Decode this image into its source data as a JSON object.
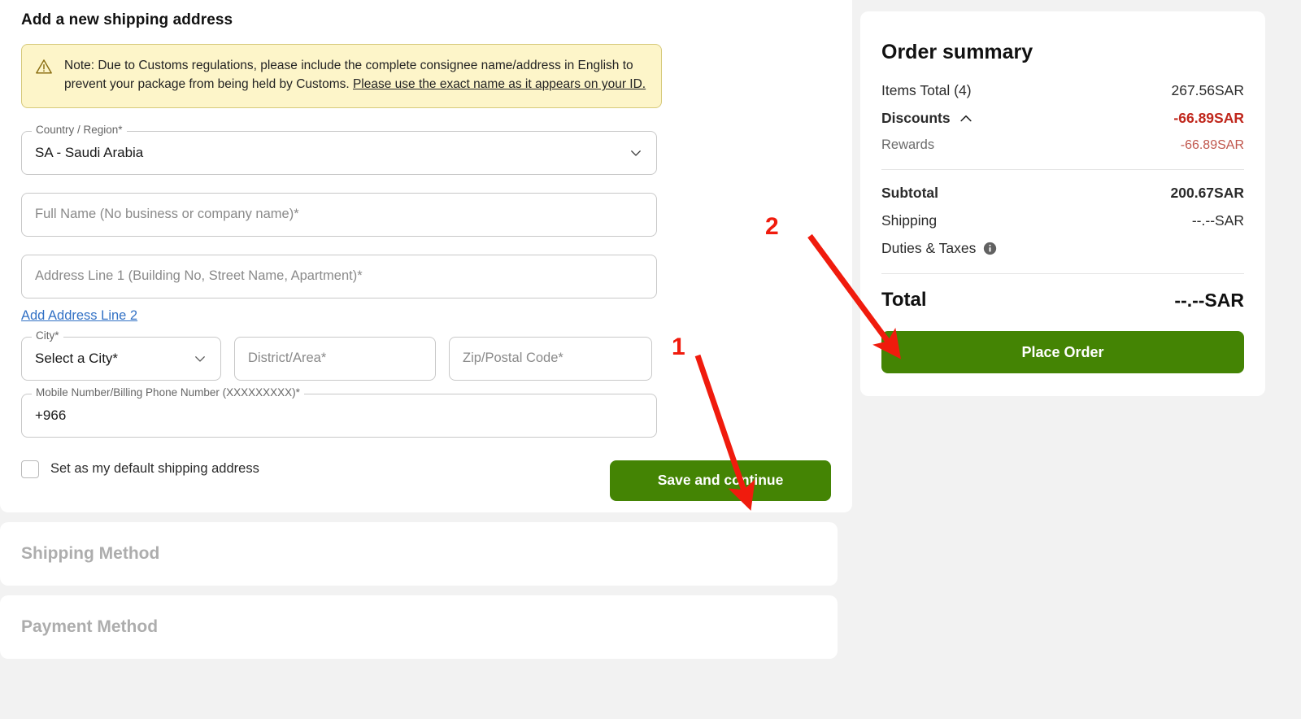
{
  "form": {
    "title": "Add a new shipping address",
    "note": {
      "icon": "warning-triangle-icon",
      "text_before": "Note: Due to Customs regulations, please include the complete consignee name/address in English to prevent your package from being held by Customs. ",
      "link_text": "Please use the exact name as it appears on your ID."
    },
    "country": {
      "legend": "Country / Region*",
      "value": "SA - Saudi Arabia",
      "icon": "chevron-down-icon"
    },
    "full_name": {
      "placeholder": "Full Name (No business or company name)*"
    },
    "address_line_1": {
      "placeholder": "Address Line 1 (Building No, Street Name, Apartment)*"
    },
    "add_address_line_2_link": "Add Address Line 2",
    "city": {
      "legend": "City*",
      "value": "Select a City*",
      "icon": "chevron-down-icon"
    },
    "district": {
      "placeholder": "District/Area*"
    },
    "zip": {
      "placeholder": "Zip/Postal Code*"
    },
    "phone": {
      "legend": "Mobile Number/Billing Phone Number (XXXXXXXXX)*",
      "value": "+966"
    },
    "default_checkbox_label": "Set as my default shipping address",
    "save_button": "Save and continue"
  },
  "sections": {
    "shipping_method": "Shipping Method",
    "payment_method": "Payment Method"
  },
  "summary": {
    "title": "Order summary",
    "rows": [
      {
        "label": "Items Total (4)",
        "value": "267.56SAR"
      },
      {
        "label": "Discounts",
        "value": "-66.89SAR"
      },
      {
        "label": "Rewards",
        "value": "-66.89SAR"
      },
      {
        "label": "Subtotal",
        "value": "200.67SAR"
      },
      {
        "label": "Shipping",
        "value": "--.--SAR"
      },
      {
        "label": "Duties & Taxes",
        "value": ""
      }
    ],
    "discounts_toggle_icon": "chevron-up-icon",
    "duties_info_icon": "info-circle-icon",
    "total_label": "Total",
    "total_value": "--.--SAR",
    "place_order_button": "Place Order"
  },
  "annotations": [
    {
      "number": "1",
      "target": "save-and-continue-button"
    },
    {
      "number": "2",
      "target": "place-order-button"
    }
  ],
  "colors": {
    "accent_green": "#448404",
    "discount_red": "#c0271c",
    "link_blue": "#3271c5",
    "note_bg": "#fdf5c9",
    "annotation_red": "#f01b0d"
  }
}
